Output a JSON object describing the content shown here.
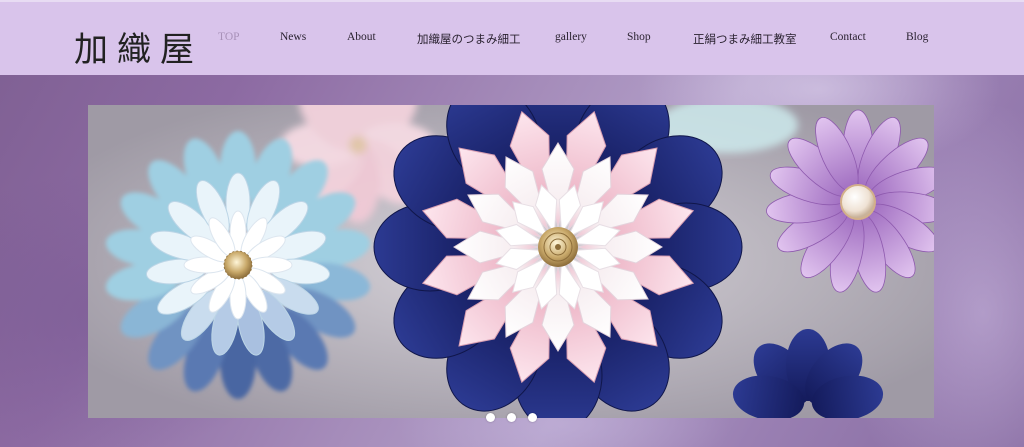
{
  "site": {
    "logo": "加織屋"
  },
  "nav": {
    "items": [
      {
        "id": "top",
        "label": "TOP",
        "active": true
      },
      {
        "id": "news",
        "label": "News"
      },
      {
        "id": "about",
        "label": "About"
      },
      {
        "id": "tsumami",
        "label": "加織屋のつまみ細工"
      },
      {
        "id": "gallery",
        "label": "gallery"
      },
      {
        "id": "shop",
        "label": "Shop"
      },
      {
        "id": "class",
        "label": "正絹つまみ細工教室"
      },
      {
        "id": "contact",
        "label": "Contact"
      },
      {
        "id": "blog",
        "label": "Blog"
      }
    ]
  },
  "slider": {
    "current": 1,
    "total": 3
  },
  "colors": {
    "header_bg": "#d9c4eb",
    "active_nav": "#a891b8",
    "navy_petal": "#1f2a78",
    "pink_petal": "#f2c6d4",
    "lilac_petal": "#b58ad0",
    "light_blue_petal": "#9fd3e2"
  }
}
